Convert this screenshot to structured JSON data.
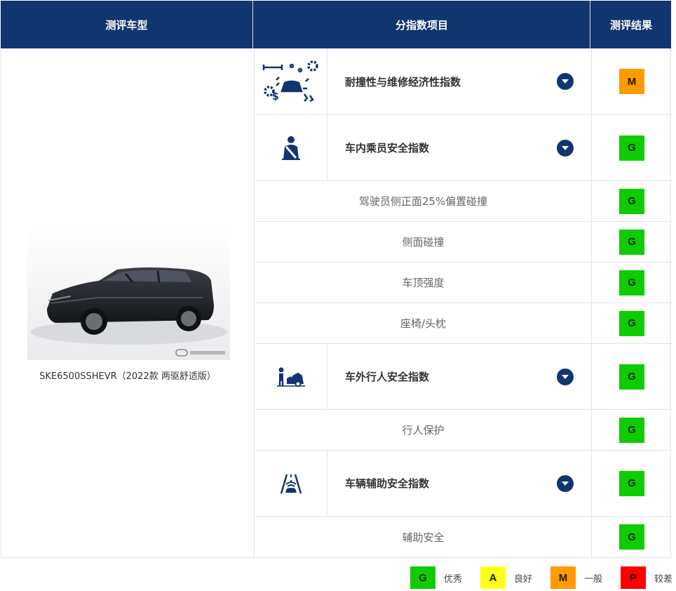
{
  "header": {
    "col_model": "测评车型",
    "col_item": "分指数项目",
    "col_result": "测评结果"
  },
  "car": {
    "caption": "SKE6500SSHEVR（2022款 两驱舒适版）"
  },
  "rows": [
    {
      "kind": "main",
      "label": "耐撞性与维修经济性指数",
      "icon": "crash-repair-icon",
      "result": "M"
    },
    {
      "kind": "main",
      "label": "车内乘员安全指数",
      "icon": "occupant-seatbelt-icon",
      "result": "G"
    },
    {
      "kind": "sub",
      "label": "驾驶员侧正面25%偏置碰撞",
      "result": "G"
    },
    {
      "kind": "sub",
      "label": "侧面碰撞",
      "result": "G"
    },
    {
      "kind": "sub",
      "label": "车顶强度",
      "result": "G"
    },
    {
      "kind": "sub",
      "label": "座椅/头枕",
      "result": "G"
    },
    {
      "kind": "main",
      "label": "车外行人安全指数",
      "icon": "pedestrian-icon",
      "result": "G"
    },
    {
      "kind": "sub",
      "label": "行人保护",
      "result": "G"
    },
    {
      "kind": "main",
      "label": "车辆辅助安全指数",
      "icon": "lane-assist-icon",
      "result": "G"
    },
    {
      "kind": "sub",
      "label": "辅助安全",
      "result": "G"
    }
  ],
  "legend": [
    {
      "grade": "G",
      "text": "优秀",
      "color": "#0fcc00"
    },
    {
      "grade": "A",
      "text": "良好",
      "color": "#ffff1a"
    },
    {
      "grade": "M",
      "text": "一般",
      "color": "#ff9a00"
    },
    {
      "grade": "P",
      "text": "较差",
      "color": "#ff0000"
    }
  ],
  "colors": {
    "header_bg": "#11356e",
    "border": "#e1e4ea"
  }
}
